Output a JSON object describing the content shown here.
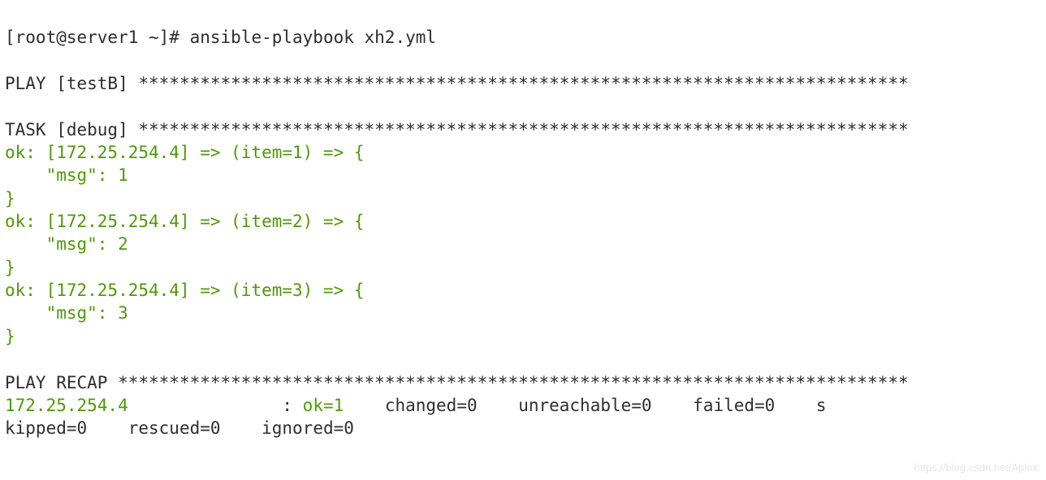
{
  "prompt": "[root@server1 ~]#",
  "command": "ansible-playbook xh2.yml",
  "play": {
    "label": "PLAY [testB]",
    "stars": "***************************************************************************"
  },
  "task": {
    "label": "TASK [debug]",
    "stars": "***************************************************************************",
    "items": [
      {
        "line1": "ok: [172.25.254.4] => (item=1) => {",
        "line2": "    \"msg\": 1",
        "line3": "}"
      },
      {
        "line1": "ok: [172.25.254.4] => (item=2) => {",
        "line2": "    \"msg\": 2",
        "line3": "}"
      },
      {
        "line1": "ok: [172.25.254.4] => (item=3) => {",
        "line2": "    \"msg\": 3",
        "line3": "}"
      }
    ]
  },
  "recap": {
    "label": "PLAY RECAP",
    "stars": "*****************************************************************************",
    "host": "172.25.254.4",
    "pad1": "               ",
    "ok": "ok=1",
    "changed": "changed=0",
    "unreachable": "unreachable=0",
    "failed": "failed=0",
    "skipped_part1": "s",
    "skipped_part2": "kipped=0",
    "rescued": "rescued=0",
    "ignored": "ignored=0"
  },
  "watermark": "https://blog.csdn.net/Aplox"
}
